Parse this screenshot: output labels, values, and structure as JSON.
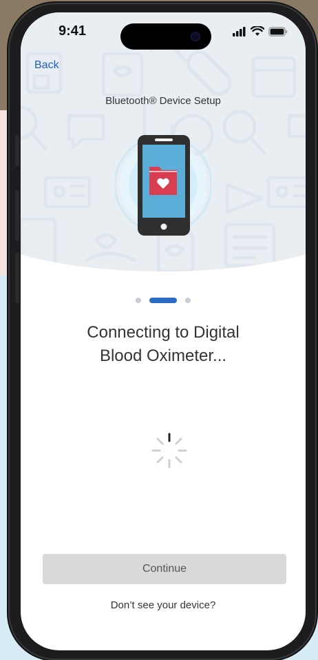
{
  "status_bar": {
    "time": "9:41",
    "icons": [
      "signal-icon",
      "wifi-icon",
      "battery-icon"
    ]
  },
  "nav": {
    "back_label": "Back"
  },
  "setup": {
    "title": "Bluetooth® Device Setup",
    "illustration": "phone-with-health-folder-icon",
    "steps_total": 3,
    "active_step": 2
  },
  "main": {
    "heading_line1": "Connecting to Digital",
    "heading_line2": "Blood Oximeter...",
    "loading": "spinner-icon"
  },
  "footer": {
    "continue_label": "Continue",
    "continue_enabled": false,
    "help_link": "Don’t see your device?"
  },
  "colors": {
    "accent": "#2b6cc4",
    "back_link": "#1f5fbf",
    "folder": "#d83d52",
    "button_disabled": "#d9d9d9"
  }
}
